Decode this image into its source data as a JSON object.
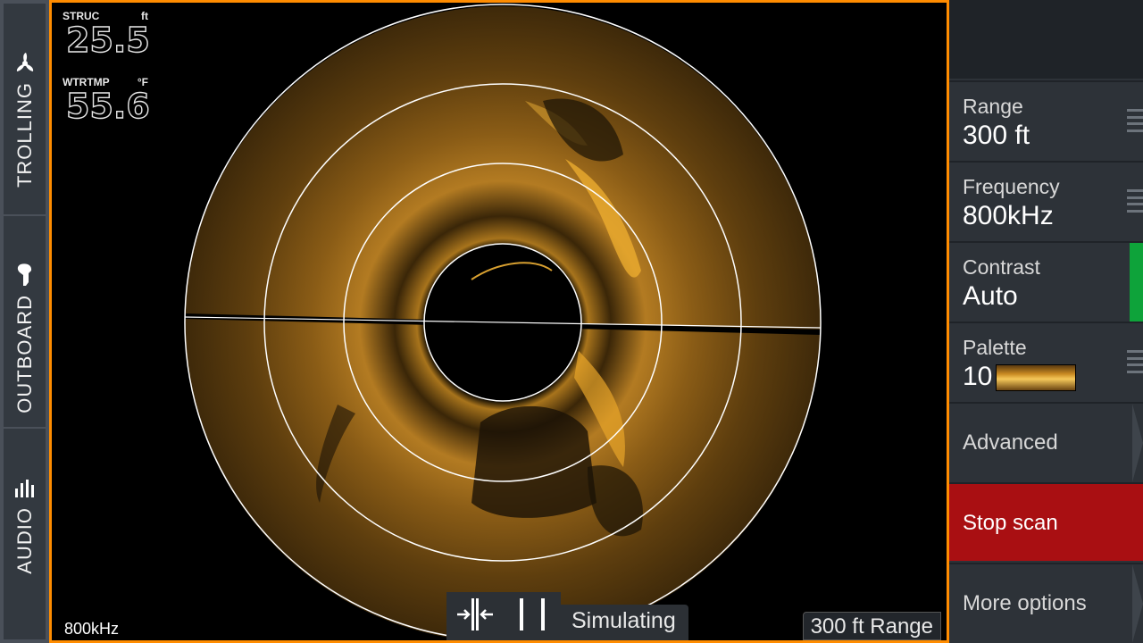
{
  "rail": {
    "tabs": [
      {
        "label": "TROLLING",
        "icon": "propeller-icon"
      },
      {
        "label": "OUTBOARD",
        "icon": "outboard-motor-icon"
      },
      {
        "label": "AUDIO",
        "icon": "audio-bars-icon"
      }
    ]
  },
  "overlay": {
    "struc_label": "STRUC",
    "struc_unit": "ft",
    "struc_value": "25.5",
    "wtrtmp_label": "WTRTMP",
    "wtrtmp_unit": "°F",
    "wtrtmp_value": "55.6",
    "frequency": "800kHz",
    "simulating": "Simulating",
    "range": "300 ft Range"
  },
  "menu": {
    "range_label": "Range",
    "range_value": "300 ft",
    "frequency_label": "Frequency",
    "frequency_value": "800kHz",
    "contrast_label": "Contrast",
    "contrast_value": "Auto",
    "palette_label": "Palette",
    "palette_value": "10",
    "advanced_label": "Advanced",
    "stop_label": "Stop scan",
    "more_label": "More options"
  },
  "colors": {
    "accent": "#ff8c00",
    "stop": "#a90f12",
    "indicator": "#0ea33a",
    "sonar_gold": "#d9a23a"
  }
}
